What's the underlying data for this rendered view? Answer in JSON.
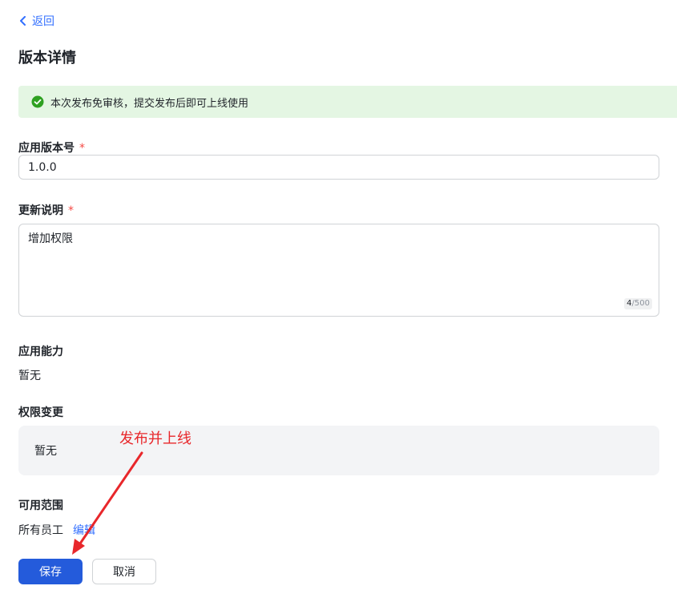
{
  "nav": {
    "back_label": "返回"
  },
  "page": {
    "title": "版本详情"
  },
  "notice": {
    "text": "本次发布免审核，提交发布后即可上线使用",
    "color": "#2ea121"
  },
  "form": {
    "version": {
      "label": "应用版本号",
      "required_mark": "*",
      "value": "1.0.0"
    },
    "description": {
      "label": "更新说明",
      "required_mark": "*",
      "value": "增加权限",
      "count": "4",
      "max": "/500"
    },
    "capabilities": {
      "label": "应用能力",
      "value": "暂无"
    },
    "permission_changes": {
      "label": "权限变更",
      "value": "暂无"
    },
    "scope": {
      "label": "可用范围",
      "value": "所有员工",
      "edit_label": "编辑"
    }
  },
  "actions": {
    "save_label": "保存",
    "cancel_label": "取消"
  },
  "annotation": {
    "text": "发布并上线",
    "color": "#e8272b"
  },
  "icons": {
    "back": "chevron-left-icon",
    "notice": "check-circle-icon"
  }
}
